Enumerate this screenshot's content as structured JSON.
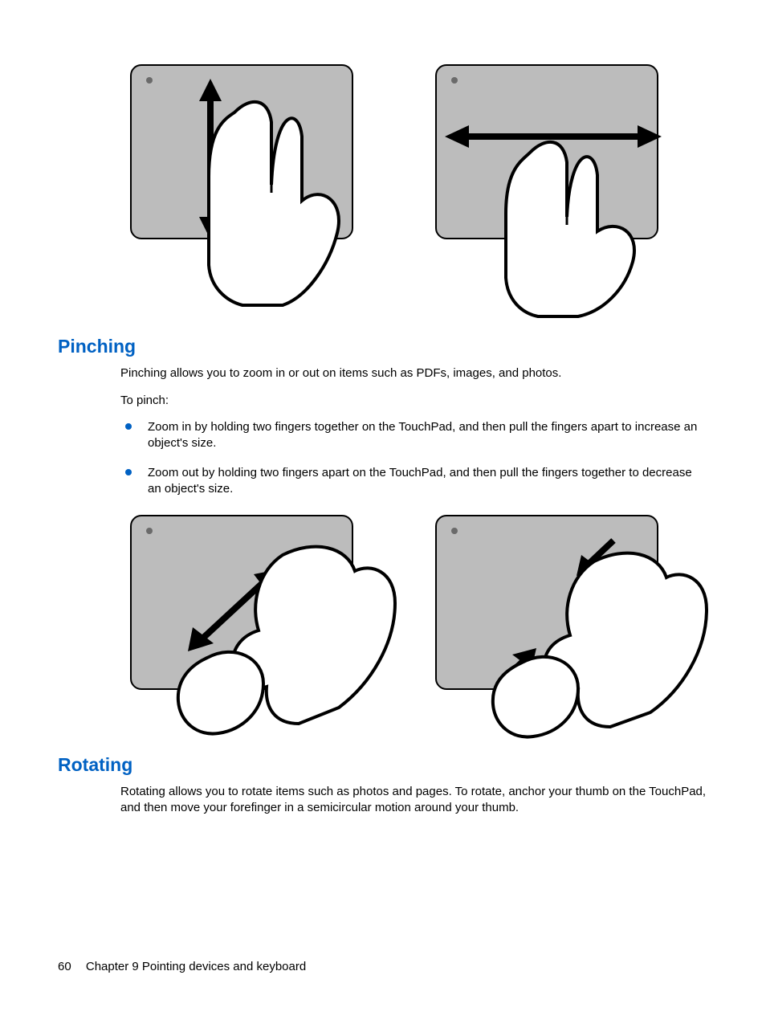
{
  "sections": {
    "pinching": {
      "heading": "Pinching",
      "intro": "Pinching allows you to zoom in or out on items such as PDFs, images, and photos.",
      "lead": "To pinch:",
      "bullets": [
        "Zoom in by holding two fingers together on the TouchPad, and then pull the fingers apart to increase an object's size.",
        "Zoom out by holding two fingers apart on the TouchPad, and then pull the fingers together to decrease an object's size."
      ]
    },
    "rotating": {
      "heading": "Rotating",
      "intro": "Rotating allows you to rotate items such as photos and pages. To rotate, anchor your thumb on the TouchPad, and then move your forefinger in a semicircular motion around your thumb."
    }
  },
  "footer": {
    "page_number": "60",
    "chapter_label": "Chapter 9   Pointing devices and keyboard"
  }
}
